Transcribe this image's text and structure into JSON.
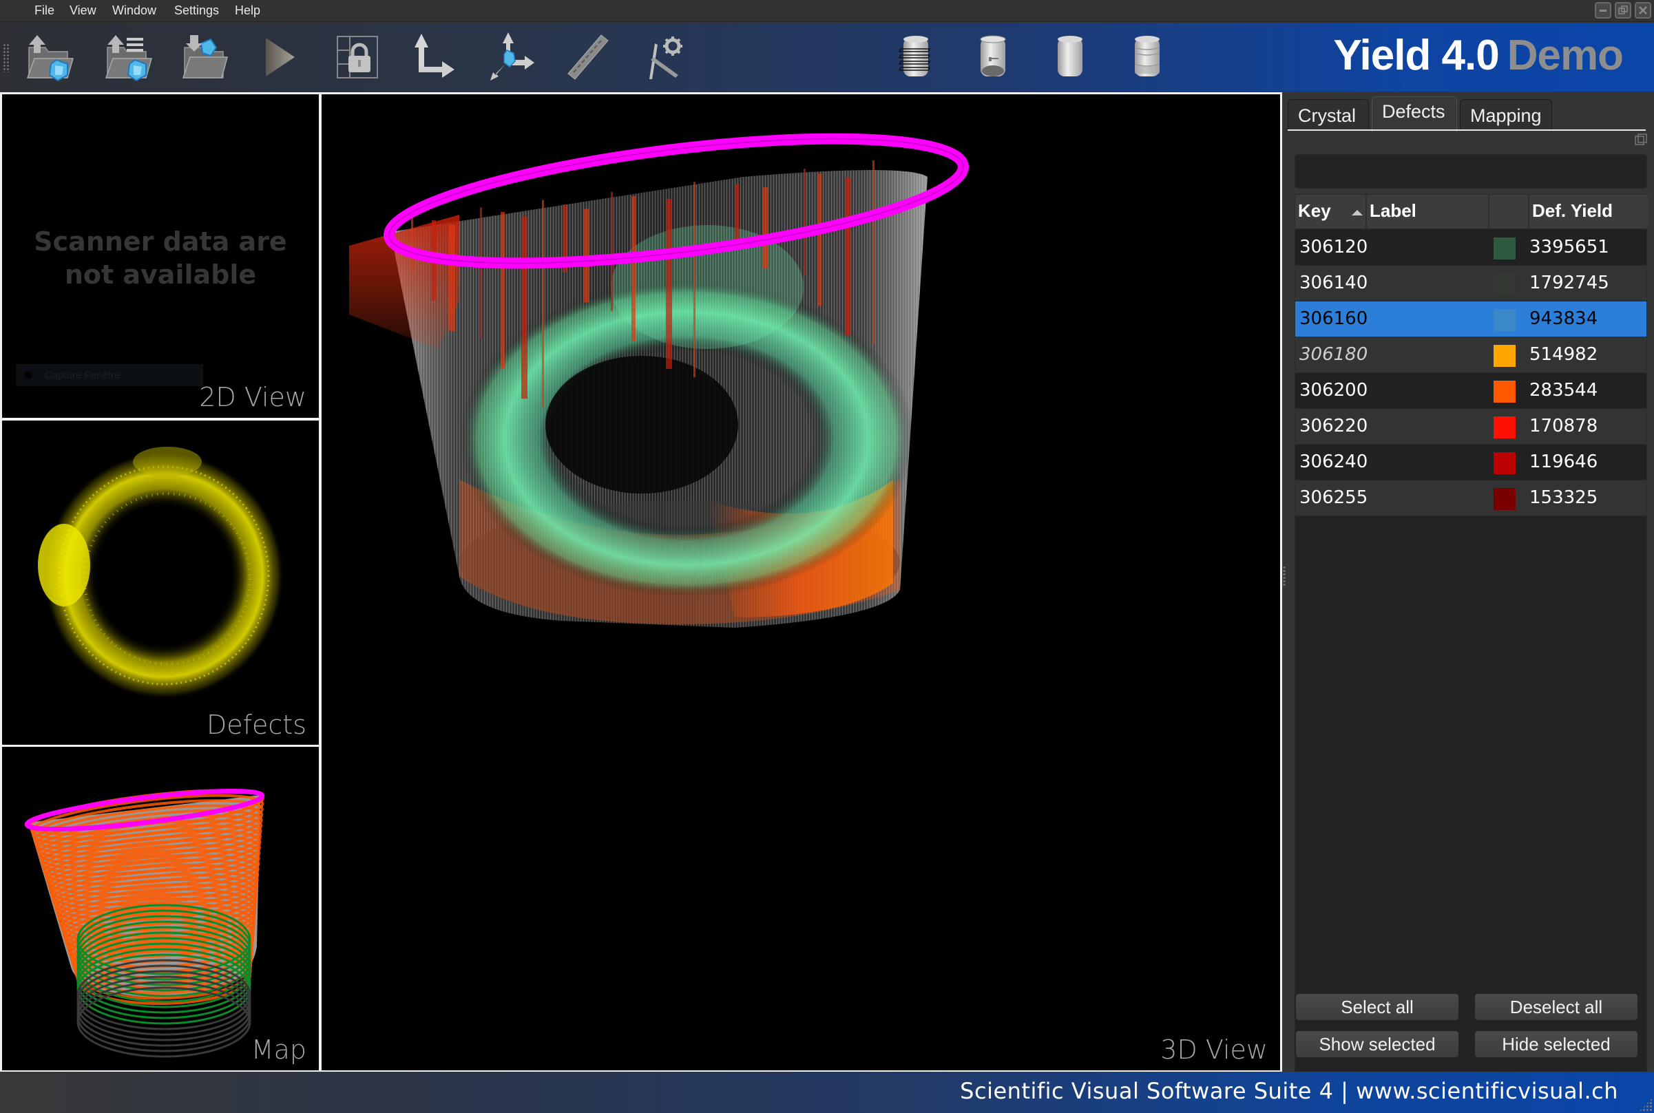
{
  "menu": [
    "File",
    "View",
    "Window",
    "Settings",
    "Help"
  ],
  "window_controls": {
    "minimize": "minimize-icon",
    "restore": "restore-icon",
    "close": "close-icon"
  },
  "toolbar": {
    "tools": [
      {
        "name": "open-crystal",
        "icon": "folder-upload-crystal-icon"
      },
      {
        "name": "open-crystal-list",
        "icon": "folder-list-crystal-icon"
      },
      {
        "name": "import-crystal",
        "icon": "folder-download-crystal-icon"
      },
      {
        "name": "run",
        "icon": "play-icon"
      },
      {
        "name": "lock-layout",
        "icon": "grid-lock-icon"
      },
      {
        "name": "axes-2d",
        "icon": "axes-2d-icon"
      },
      {
        "name": "axes-3d-crystal",
        "icon": "axes-3d-crystal-icon"
      },
      {
        "name": "ruler",
        "icon": "ruler-icon"
      },
      {
        "name": "tools-settings",
        "icon": "pick-gear-icon"
      },
      {
        "name": "cylinder-slices",
        "icon": "cylinder-slices-icon"
      },
      {
        "name": "cylinder-section",
        "icon": "cylinder-section-icon"
      },
      {
        "name": "cylinder-plain",
        "icon": "cylinder-icon"
      },
      {
        "name": "cylinder-layers",
        "icon": "cylinder-layers-icon"
      }
    ],
    "brand_main": "Yield 4.0",
    "brand_suffix": "Demo"
  },
  "views": {
    "view2d": {
      "label": "2D View",
      "message_line1": "Scanner data are",
      "message_line2": "not available",
      "capture_label": "Capture Fenêtre"
    },
    "defects": {
      "label": "Defects"
    },
    "map": {
      "label": "Map"
    },
    "view3d": {
      "label": "3D View"
    }
  },
  "dock": {
    "tabs": [
      {
        "label": "Crystal",
        "active": false
      },
      {
        "label": "Defects",
        "active": true
      },
      {
        "label": "Mapping",
        "active": false
      }
    ],
    "filter_value": "",
    "table": {
      "columns": [
        "Key",
        "Label",
        "",
        "Def. Yield"
      ],
      "sort_column": "Key",
      "sort_direction": "ascending",
      "rows": [
        {
          "key": "306120",
          "label": "",
          "color": "#2e5a42",
          "yield": "3395651",
          "selected": false,
          "italic": false
        },
        {
          "key": "306140",
          "label": "",
          "color": "#343832",
          "yield": "1792745",
          "selected": false,
          "italic": false
        },
        {
          "key": "306160",
          "label": "",
          "color": "#3a88c8",
          "yield": "943834",
          "selected": true,
          "italic": false
        },
        {
          "key": "306180",
          "label": "",
          "color": "#ffa500",
          "yield": "514982",
          "selected": false,
          "italic": true
        },
        {
          "key": "306200",
          "label": "",
          "color": "#ff5a00",
          "yield": "283544",
          "selected": false,
          "italic": false
        },
        {
          "key": "306220",
          "label": "",
          "color": "#ff1000",
          "yield": "170878",
          "selected": false,
          "italic": false
        },
        {
          "key": "306240",
          "label": "",
          "color": "#bb0000",
          "yield": "119646",
          "selected": false,
          "italic": false
        },
        {
          "key": "306255",
          "label": "",
          "color": "#7a0000",
          "yield": "153325",
          "selected": false,
          "italic": false
        }
      ]
    },
    "buttons": {
      "select_all": "Select all",
      "deselect_all": "Deselect all",
      "show_selected": "Show selected",
      "hide_selected": "Hide selected"
    }
  },
  "footer": {
    "text": "Scientific Visual Software Suite 4 | www.scientificvisual.ch"
  },
  "colors": {
    "accent_selection": "#2b7fd8",
    "brand_blue": "#0a45a8",
    "top_ring": "#ff00ff",
    "defects_yellow": "#e8e000"
  }
}
